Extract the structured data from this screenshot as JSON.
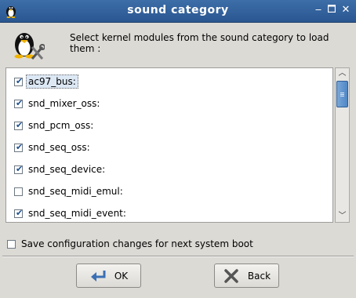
{
  "window": {
    "title": "sound category",
    "controls": [
      "minimize-icon",
      "maximize-icon",
      "close-icon"
    ]
  },
  "header": {
    "description": "Select kernel modules from the sound category to load them :"
  },
  "modules": [
    {
      "label": "ac97_bus:",
      "checked": true,
      "focused": true
    },
    {
      "label": "snd_mixer_oss:",
      "checked": true
    },
    {
      "label": "snd_pcm_oss:",
      "checked": true
    },
    {
      "label": "snd_seq_oss:",
      "checked": true
    },
    {
      "label": "snd_seq_device:",
      "checked": true
    },
    {
      "label": "snd_seq_midi_emul:",
      "checked": false
    },
    {
      "label": "snd_seq_midi_event:",
      "checked": true
    }
  ],
  "save_option": {
    "label": "Save configuration changes for next system boot",
    "checked": false
  },
  "buttons": {
    "ok": "OK",
    "back": "Back"
  },
  "colors": {
    "titlebar": "#2f5e96",
    "accent": "#4e86c6",
    "window_bg": "#dcdad5"
  }
}
